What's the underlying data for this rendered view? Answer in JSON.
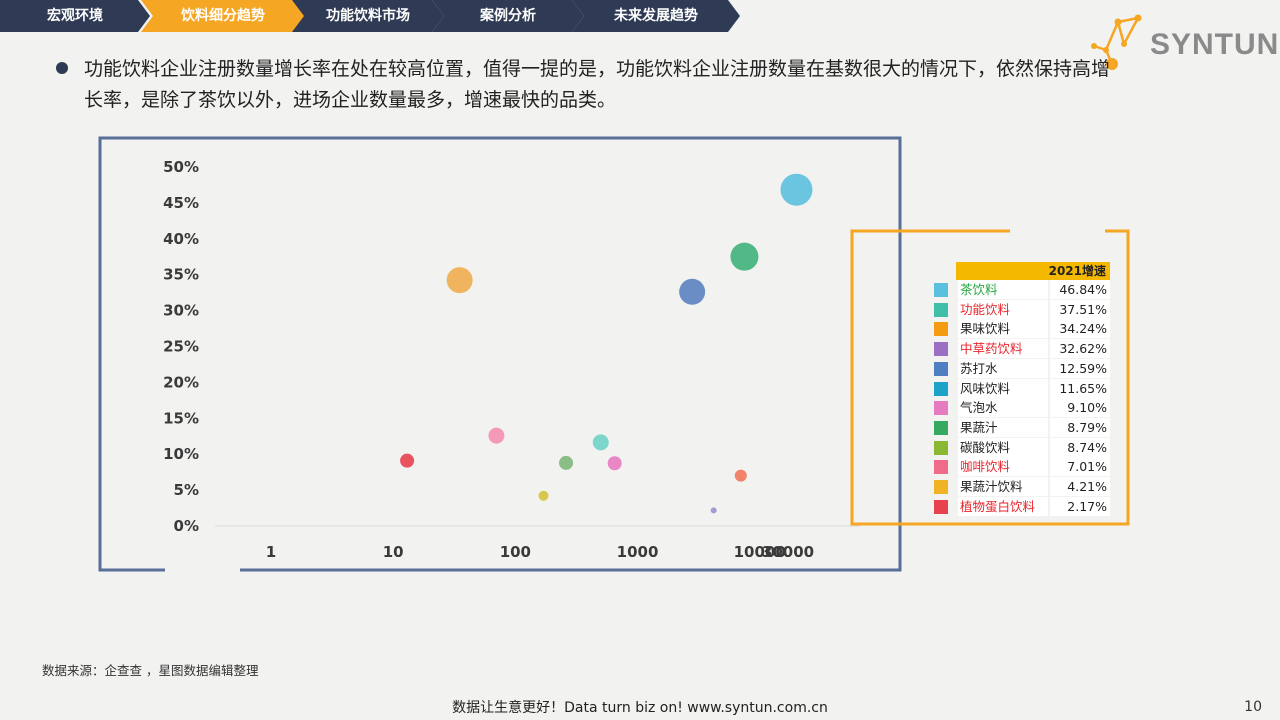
{
  "nav": {
    "items": [
      {
        "label": "宏观环境",
        "active": false
      },
      {
        "label": "饮料细分趋势",
        "active": true
      },
      {
        "label": "功能饮料市场",
        "active": false
      },
      {
        "label": "案例分析",
        "active": false
      },
      {
        "label": "未来发展趋势",
        "active": false
      }
    ],
    "colors": {
      "default": "#2f3a55",
      "active": "#f5a623"
    }
  },
  "logo": {
    "text": "SYNTUN",
    "icon": "molecule-logo-icon",
    "accent_color": "#f5a623"
  },
  "bullet": {
    "text": "功能饮料企业注册数量增长率在处在较高位置，值得一提的是，功能饮料企业注册数量在基数很大的情况下，依然保持高增长率，是除了茶饮以外，进场企业数量最多，增速最快的品类。"
  },
  "chart_data": {
    "type": "scatter",
    "subtype": "bubble",
    "x_scale": "log",
    "x_tick_labels": [
      "1",
      "10",
      "100",
      "1000",
      "10000",
      "30000"
    ],
    "y_tick_labels": [
      "0%",
      "5%",
      "10%",
      "15%",
      "20%",
      "25%",
      "30%",
      "35%",
      "40%",
      "45%",
      "50%"
    ],
    "ylim": [
      0,
      50
    ],
    "y_unit": "%",
    "grid": false,
    "legend_placement": "right",
    "legend_header": "2021增速",
    "series": [
      {
        "name": "茶饮料",
        "value_label": "46.84%",
        "y": 46.84,
        "x": 20000,
        "color": "#5bc0de",
        "name_color": "#27a844"
      },
      {
        "name": "功能饮料",
        "value_label": "37.51%",
        "y": 37.51,
        "x": 7500,
        "color": "#3fbfa8",
        "name_color": "#e8262d"
      },
      {
        "name": "果味饮料",
        "value_label": "34.24%",
        "y": 34.24,
        "x": 35,
        "color": "#f39c12",
        "name_color": "#222222"
      },
      {
        "name": "中草药饮料",
        "value_label": "32.62%",
        "y": 32.62,
        "x": 2800,
        "color": "#9b6fc4",
        "name_color": "#e8262d"
      },
      {
        "name": "苏打水",
        "value_label": "12.59%",
        "y": 12.59,
        "x": 70,
        "color": "#4f7fc0",
        "name_color": "#222222"
      },
      {
        "name": "风味饮料",
        "value_label": "11.65%",
        "y": 11.65,
        "x": 500,
        "color": "#1fa2c8",
        "name_color": "#222222"
      },
      {
        "name": "气泡水",
        "value_label": "9.10%",
        "y": 9.1,
        "x": 650,
        "color": "#e77bbf",
        "name_color": "#222222"
      },
      {
        "name": "果蔬汁",
        "value_label": "8.79%",
        "y": 8.79,
        "x": 260,
        "color": "#35a960",
        "name_color": "#222222"
      },
      {
        "name": "碳酸饮料",
        "value_label": "8.74%",
        "y": 8.74,
        "x": 14,
        "color": "#8ab833",
        "name_color": "#222222"
      },
      {
        "name": "咖啡饮料",
        "value_label": "7.01%",
        "y": 7.01,
        "x": 7000,
        "color": "#f06a8a",
        "name_color": "#e8262d"
      },
      {
        "name": "果蔬汁饮料",
        "value_label": "4.21%",
        "y": 4.21,
        "x": 170,
        "color": "#f0b323",
        "name_color": "#222222"
      },
      {
        "name": "植物蛋白饮料",
        "value_label": "2.17%",
        "y": 2.17,
        "x": 4200,
        "color": "#e8414f",
        "name_color": "#e8262d"
      }
    ],
    "bubbles": [
      {
        "y": 46.84,
        "x": 20000,
        "size": 16,
        "color": "#5bc0de"
      },
      {
        "y": 37.51,
        "x": 7500,
        "size": 14,
        "color": "#3fb27a"
      },
      {
        "y": 34.24,
        "x": 35,
        "size": 13,
        "color": "#f0ad4e"
      },
      {
        "y": 32.62,
        "x": 2800,
        "size": 13,
        "color": "#5b82c0"
      },
      {
        "y": 12.59,
        "x": 70,
        "size": 8,
        "color": "#f48fb1"
      },
      {
        "y": 11.65,
        "x": 500,
        "size": 8,
        "color": "#6fd3c8"
      },
      {
        "y": 9.1,
        "x": 13,
        "size": 7,
        "color": "#e8414f"
      },
      {
        "y": 8.79,
        "x": 260,
        "size": 7,
        "color": "#7fb87a"
      },
      {
        "y": 8.74,
        "x": 650,
        "size": 7,
        "color": "#e77bbf"
      },
      {
        "y": 7.01,
        "x": 7000,
        "size": 6,
        "color": "#f0775a"
      },
      {
        "y": 4.21,
        "x": 170,
        "size": 5,
        "color": "#d4c23a"
      },
      {
        "y": 2.17,
        "x": 4200,
        "size": 3,
        "color": "#9b8fd0"
      }
    ]
  },
  "footer": {
    "source": "数据来源：企查查 ，星图数据编辑整理",
    "slogan": "数据让生意更好！Data turn biz on!  www.syntun.com.cn",
    "page_number": "10"
  },
  "frame_colors": {
    "chart_frame": "#5a6e9a",
    "legend_frame": "#f5a623"
  }
}
